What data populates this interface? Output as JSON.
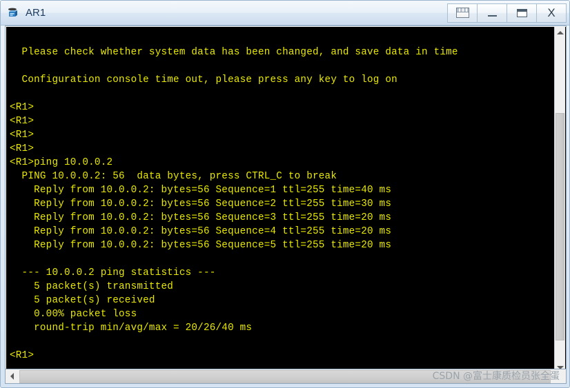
{
  "window": {
    "title": "AR1",
    "icon": "router-icon",
    "frame_color": "#9ab4cd",
    "title_color": "#1b3a5c"
  },
  "titlebar_buttons": [
    {
      "name": "panel-toggle-button",
      "glyph": "panel-icon",
      "label": ""
    },
    {
      "name": "minimize-button",
      "glyph": "minimize-icon",
      "label": ""
    },
    {
      "name": "maximize-button",
      "glyph": "maximize-icon",
      "label": ""
    },
    {
      "name": "close-button",
      "glyph": "close-icon",
      "label": "X"
    }
  ],
  "terminal": {
    "fg_color": "#e8e800",
    "bg_color": "#000000",
    "lines": [
      "",
      "  Please check whether system data has been changed, and save data in time",
      "",
      "  Configuration console time out, please press any key to log on",
      "",
      "<R1>",
      "<R1>",
      "<R1>",
      "<R1>",
      "<R1>ping 10.0.0.2",
      "  PING 10.0.0.2: 56  data bytes, press CTRL_C to break",
      "    Reply from 10.0.0.2: bytes=56 Sequence=1 ttl=255 time=40 ms",
      "    Reply from 10.0.0.2: bytes=56 Sequence=2 ttl=255 time=30 ms",
      "    Reply from 10.0.0.2: bytes=56 Sequence=3 ttl=255 time=20 ms",
      "    Reply from 10.0.0.2: bytes=56 Sequence=4 ttl=255 time=20 ms",
      "    Reply from 10.0.0.2: bytes=56 Sequence=5 ttl=255 time=20 ms",
      "",
      "  --- 10.0.0.2 ping statistics ---",
      "    5 packet(s) transmitted",
      "    5 packet(s) received",
      "    0.00% packet loss",
      "    round-trip min/avg/max = 20/26/40 ms",
      "",
      "<R1>"
    ]
  },
  "scrollbars": {
    "vertical": {
      "up_icon": "chevron-up-icon",
      "down_icon": "chevron-down-icon"
    },
    "horizontal": {
      "left_icon": "chevron-left-icon"
    }
  },
  "watermark": {
    "text": "CSDN @富士康质检员张全蛋"
  }
}
